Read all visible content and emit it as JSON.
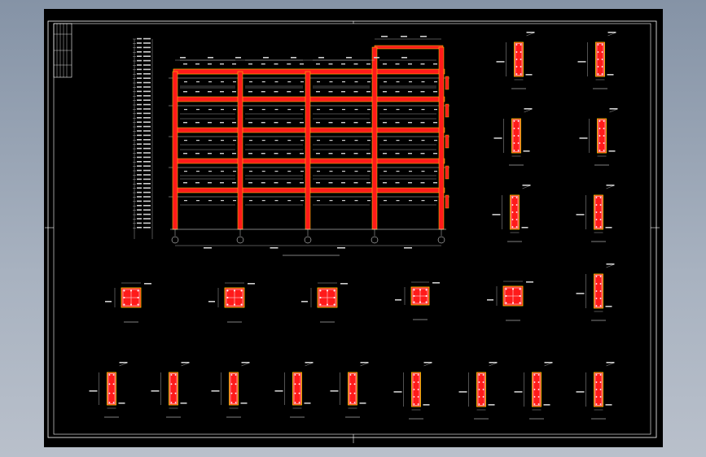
{
  "colors": {
    "background": "#000000",
    "frame": "#ffffff",
    "beam": "#ff1a1a",
    "beam_edge": "#ffd400",
    "rebar": "#ffffff",
    "dim": "#cfcfcf"
  },
  "elevation": {
    "title": "",
    "axis_labels": [
      "",
      "",
      "",
      "",
      ""
    ]
  },
  "sections": {
    "top_right": [
      "",
      "",
      "",
      "",
      "",
      "",
      "",
      ""
    ],
    "columns": [
      "",
      "",
      "",
      "",
      ""
    ],
    "column_side": "",
    "bottom": [
      "",
      "",
      "",
      "",
      "",
      "",
      "",
      "",
      "",
      ""
    ]
  }
}
